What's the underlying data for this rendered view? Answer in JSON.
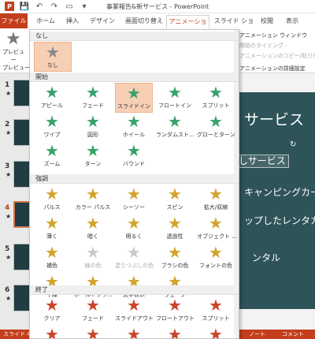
{
  "window": {
    "title": "事業報告&新サービス - PowerPoint"
  },
  "ribbon_tabs": [
    {
      "label": "ファイル"
    },
    {
      "label": "ホーム"
    },
    {
      "label": "挿入"
    },
    {
      "label": "デザイン"
    },
    {
      "label": "画面切り替え"
    },
    {
      "label": "アニメーション"
    },
    {
      "label": "スライド ショー"
    },
    {
      "label": "校閲"
    },
    {
      "label": "表示"
    }
  ],
  "ribbon": {
    "preview_label": "プレビュー",
    "preview_group": "プレビュー",
    "animation_window": "アニメーション ウィンドウ",
    "timing_label": "開始のタイミング -",
    "copy_paste": "アニメーションのコピー/貼り付け",
    "detail_settings": "アニメーションの詳細設定"
  },
  "thumbnails": [
    {
      "num": "1",
      "mark": "★"
    },
    {
      "num": "2",
      "mark": "★"
    },
    {
      "num": "3",
      "mark": "★"
    },
    {
      "num": "4",
      "mark": "★"
    },
    {
      "num": "5",
      "mark": "★"
    },
    {
      "num": "6",
      "mark": "★"
    }
  ],
  "slide": {
    "title": "サービス",
    "selected_text": "しサービス",
    "line1": "キャンピングカー",
    "line2": "ップしたレンタカ",
    "line3": "ンタル"
  },
  "status": {
    "slide_indicator": "スライド 4/",
    "notes": "ノート",
    "comments": "コメント"
  },
  "gallery": {
    "sections": [
      "なし",
      "開始",
      "強調",
      "終了"
    ],
    "none": [
      {
        "label": "なし",
        "icon": "star-grey",
        "highlighted": true
      }
    ],
    "entrance": [
      {
        "label": "アピール",
        "color": "green"
      },
      {
        "label": "フェード",
        "color": "green"
      },
      {
        "label": "スライドイン",
        "color": "green",
        "highlighted": true
      },
      {
        "label": "フロートイン",
        "color": "green"
      },
      {
        "label": "スプリット",
        "color": "green"
      },
      {
        "label": "ワイプ",
        "color": "green"
      },
      {
        "label": "図形",
        "color": "green"
      },
      {
        "label": "ホイール",
        "color": "green"
      },
      {
        "label": "ランダムスト...",
        "color": "green"
      },
      {
        "label": "グローとターン",
        "color": "green"
      },
      {
        "label": "ズーム",
        "color": "green"
      },
      {
        "label": "ターン",
        "color": "green"
      },
      {
        "label": "バウンド",
        "color": "green"
      }
    ],
    "emphasis": [
      {
        "label": "パルス",
        "color": "gold"
      },
      {
        "label": "カラー パルス",
        "color": "gold"
      },
      {
        "label": "シーソー",
        "color": "gold"
      },
      {
        "label": "スピン",
        "color": "gold"
      },
      {
        "label": "拡大/収縮",
        "color": "gold"
      },
      {
        "label": "薄く",
        "color": "gold"
      },
      {
        "label": "暗く",
        "color": "gold"
      },
      {
        "label": "明るく",
        "color": "gold"
      },
      {
        "label": "透過性",
        "color": "gold"
      },
      {
        "label": "オブジェクト ...",
        "color": "gold"
      },
      {
        "label": "補色",
        "color": "gold"
      },
      {
        "label": "線の色",
        "color": "grey",
        "disabled": true
      },
      {
        "label": "塗りつぶしの色",
        "color": "grey",
        "disabled": true
      },
      {
        "label": "ブラシの色",
        "color": "gold"
      },
      {
        "label": "フォントの色",
        "color": "gold"
      },
      {
        "label": "下線",
        "color": "gold"
      },
      {
        "label": "ボールドフラ...",
        "color": "gold"
      },
      {
        "label": "太字表示",
        "color": "gold"
      },
      {
        "label": "ウェーブ",
        "color": "gold"
      }
    ],
    "exit": [
      {
        "label": "クリア",
        "color": "red"
      },
      {
        "label": "フェード",
        "color": "red"
      },
      {
        "label": "スライドアウト",
        "color": "red"
      },
      {
        "label": "フロートアウト",
        "color": "red"
      },
      {
        "label": "スプリット",
        "color": "red"
      },
      {
        "label": "",
        "color": "red"
      },
      {
        "label": "",
        "color": "red"
      },
      {
        "label": "",
        "color": "red"
      },
      {
        "label": "",
        "color": "red"
      },
      {
        "label": "",
        "color": "red"
      }
    ]
  },
  "colors": {
    "accent": "#c43e1c",
    "entrance": "#37a26a",
    "emphasis": "#d3a32c",
    "exit": "#c9452a",
    "highlight": "#f7cfb5",
    "slide_bg": "#2e5358"
  }
}
